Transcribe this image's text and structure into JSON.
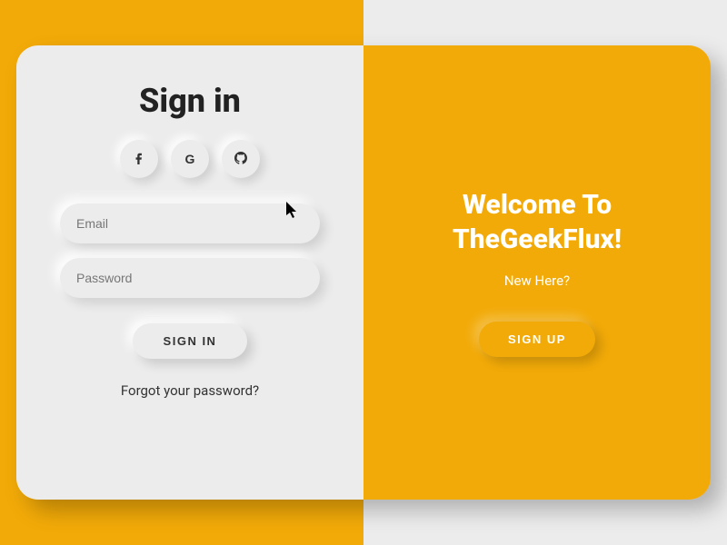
{
  "colors": {
    "accent": "#f2aa08",
    "panel": "#ececec"
  },
  "signin": {
    "title": "Sign in",
    "social": {
      "facebook": "facebook-icon",
      "google": "google-icon",
      "github": "github-icon"
    },
    "email_placeholder": "Email",
    "password_placeholder": "Password",
    "submit_label": "SIGN IN",
    "forgot_label": "Forgot your password?"
  },
  "welcome": {
    "title": "Welcome To TheGeekFlux!",
    "subtext": "New Here?",
    "signup_label": "SIGN UP"
  }
}
